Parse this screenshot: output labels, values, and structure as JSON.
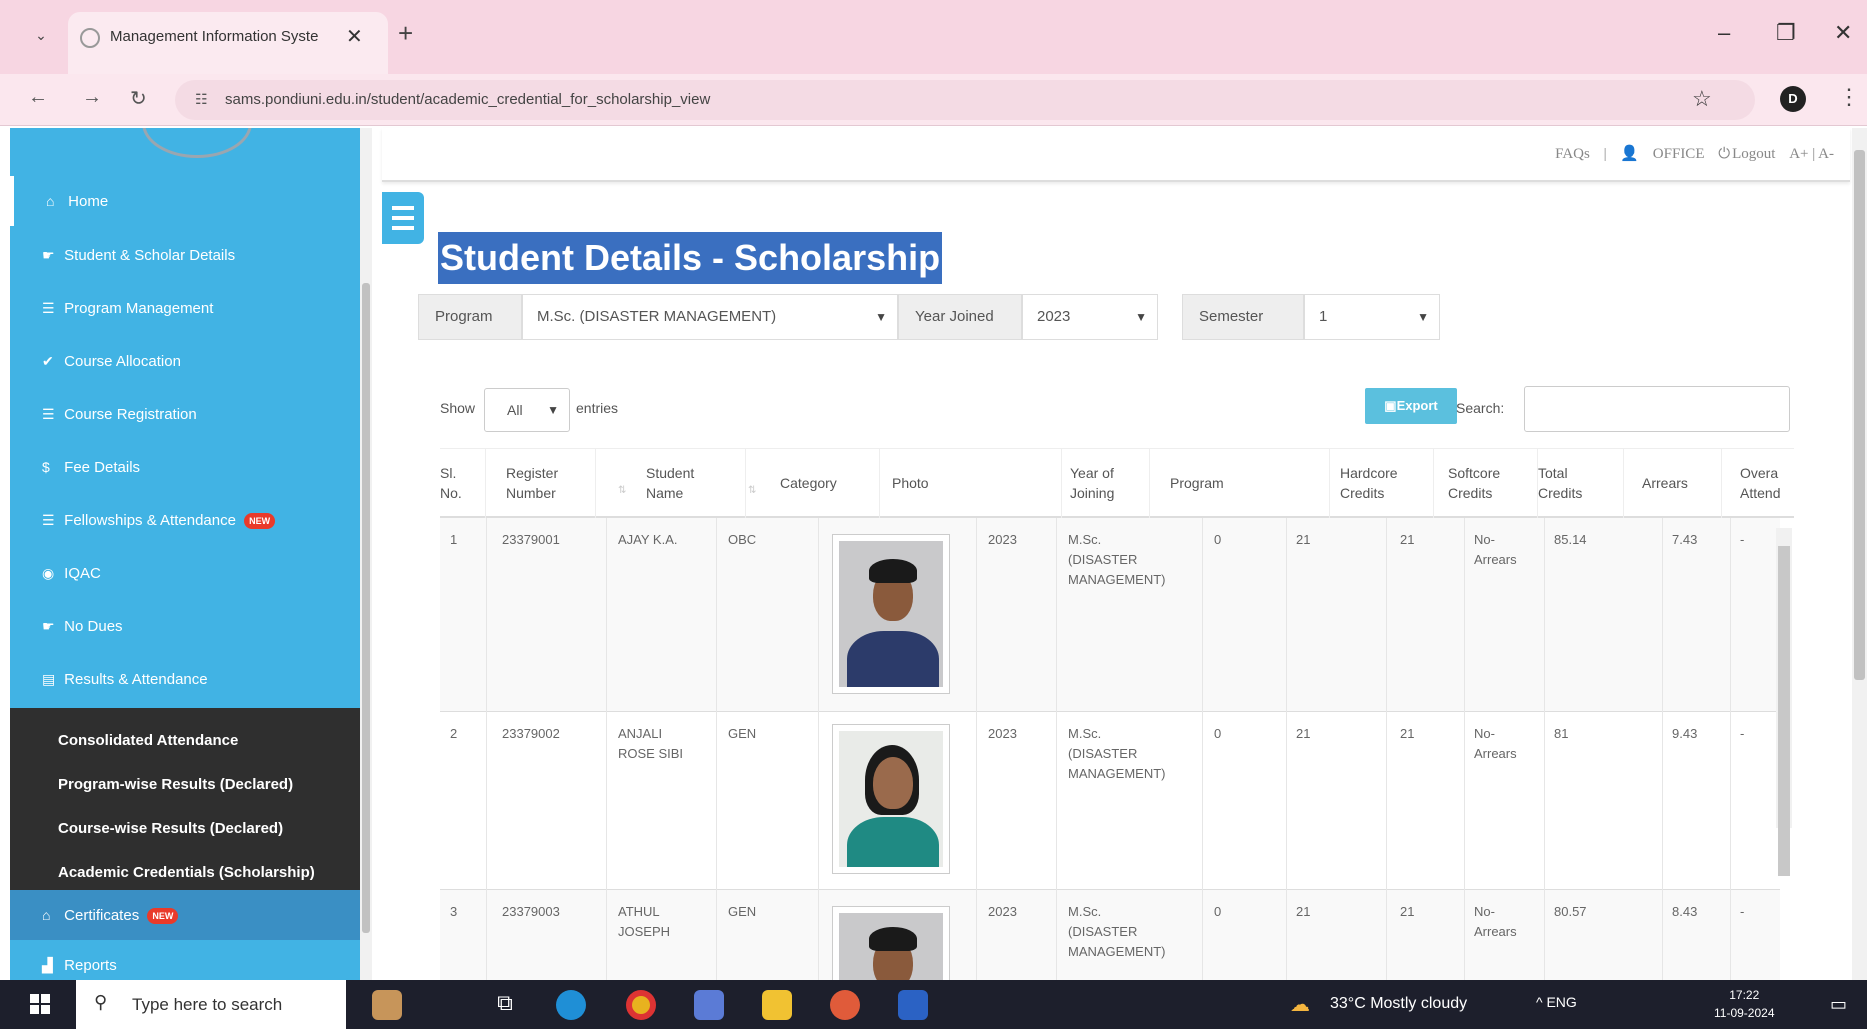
{
  "browser": {
    "tab_title": "Management Information Syste",
    "url": "sams.pondiuni.edu.in/student/academic_credential_for_scholarship_view",
    "profile_initial": "D"
  },
  "sidebar": {
    "items": [
      {
        "label": "Home",
        "icon": "home-icon"
      },
      {
        "label": "Student & Scholar Details",
        "icon": "pointer-icon"
      },
      {
        "label": "Program Management",
        "icon": "list-icon"
      },
      {
        "label": "Course Allocation",
        "icon": "check-circle-icon"
      },
      {
        "label": "Course Registration",
        "icon": "list-icon"
      },
      {
        "label": "Fee Details",
        "icon": "dollar-icon"
      },
      {
        "label": "Fellowships & Attendance",
        "icon": "list-icon",
        "badge": "NEW"
      },
      {
        "label": "IQAC",
        "icon": "eye-icon"
      },
      {
        "label": "No Dues",
        "icon": "pointer-icon"
      },
      {
        "label": "Results & Attendance",
        "icon": "list-alt-icon"
      }
    ],
    "submenu": [
      "Consolidated Attendance",
      "Program-wise Results (Declared)",
      "Course-wise Results (Declared)",
      "Academic Credentials (Scholarship)"
    ],
    "certificates": {
      "label": "Certificates",
      "badge": "NEW"
    },
    "reports": {
      "label": "Reports"
    }
  },
  "topbar": {
    "faqs": "FAQs",
    "user": "OFFICE",
    "logout": "Logout",
    "font_size": "A+ | A-"
  },
  "page": {
    "title": "Student Details - Scholarship"
  },
  "filters": {
    "program_label": "Program",
    "program_value": "M.Sc. (DISASTER MANAGEMENT)",
    "year_label": "Year Joined",
    "year_value": "2023",
    "semester_label": "Semester",
    "semester_value": "1"
  },
  "table_controls": {
    "show_label": "Show",
    "show_value": "All",
    "entries_label": "entries",
    "export_label": "Export",
    "search_label": "Search:"
  },
  "table": {
    "headers": [
      "Sl.\nNo.",
      "Register\nNumber",
      "Student\nName",
      "Category",
      "Photo",
      "Year of\nJoining",
      "Program",
      "Hardcore\nCredits",
      "Softcore\nCredits",
      "Total\nCredits",
      "Arrears",
      "Overa\nAttend"
    ],
    "rows": [
      {
        "sl": "1",
        "reg": "23379001",
        "name": "AJAY K.A.",
        "category": "OBC",
        "year": "2023",
        "program": "M.Sc.\n(DISASTER\nMANAGEMENT)",
        "c1": "0",
        "c2": "21",
        "c3": "21",
        "arrears": "No-\nArrears",
        "total": "85.14",
        "cgpa": "7.43",
        "att": "-"
      },
      {
        "sl": "2",
        "reg": "23379002",
        "name": "ANJALI\nROSE SIBI",
        "category": "GEN",
        "year": "2023",
        "program": "M.Sc.\n(DISASTER\nMANAGEMENT)",
        "c1": "0",
        "c2": "21",
        "c3": "21",
        "arrears": "No-\nArrears",
        "total": "81",
        "cgpa": "9.43",
        "att": "-"
      },
      {
        "sl": "3",
        "reg": "23379003",
        "name": "ATHUL\nJOSEPH",
        "category": "GEN",
        "year": "2023",
        "program": "M.Sc.\n(DISASTER\nMANAGEMENT)",
        "c1": "0",
        "c2": "21",
        "c3": "21",
        "arrears": "No-\nArrears",
        "total": "80.57",
        "cgpa": "8.43",
        "att": "-"
      }
    ]
  },
  "taskbar": {
    "search_placeholder": "Type here to search",
    "weather": "33°C  Mostly cloudy",
    "tray": "^  ENG",
    "time": "17:22",
    "date": "11-09-2024"
  },
  "colors": {
    "sidebar": "#41b3e4",
    "submenu": "#2f2f2f",
    "title_highlight": "#3a6fc0",
    "export": "#5bc0de",
    "tab_strip": "#f7d6e2"
  }
}
